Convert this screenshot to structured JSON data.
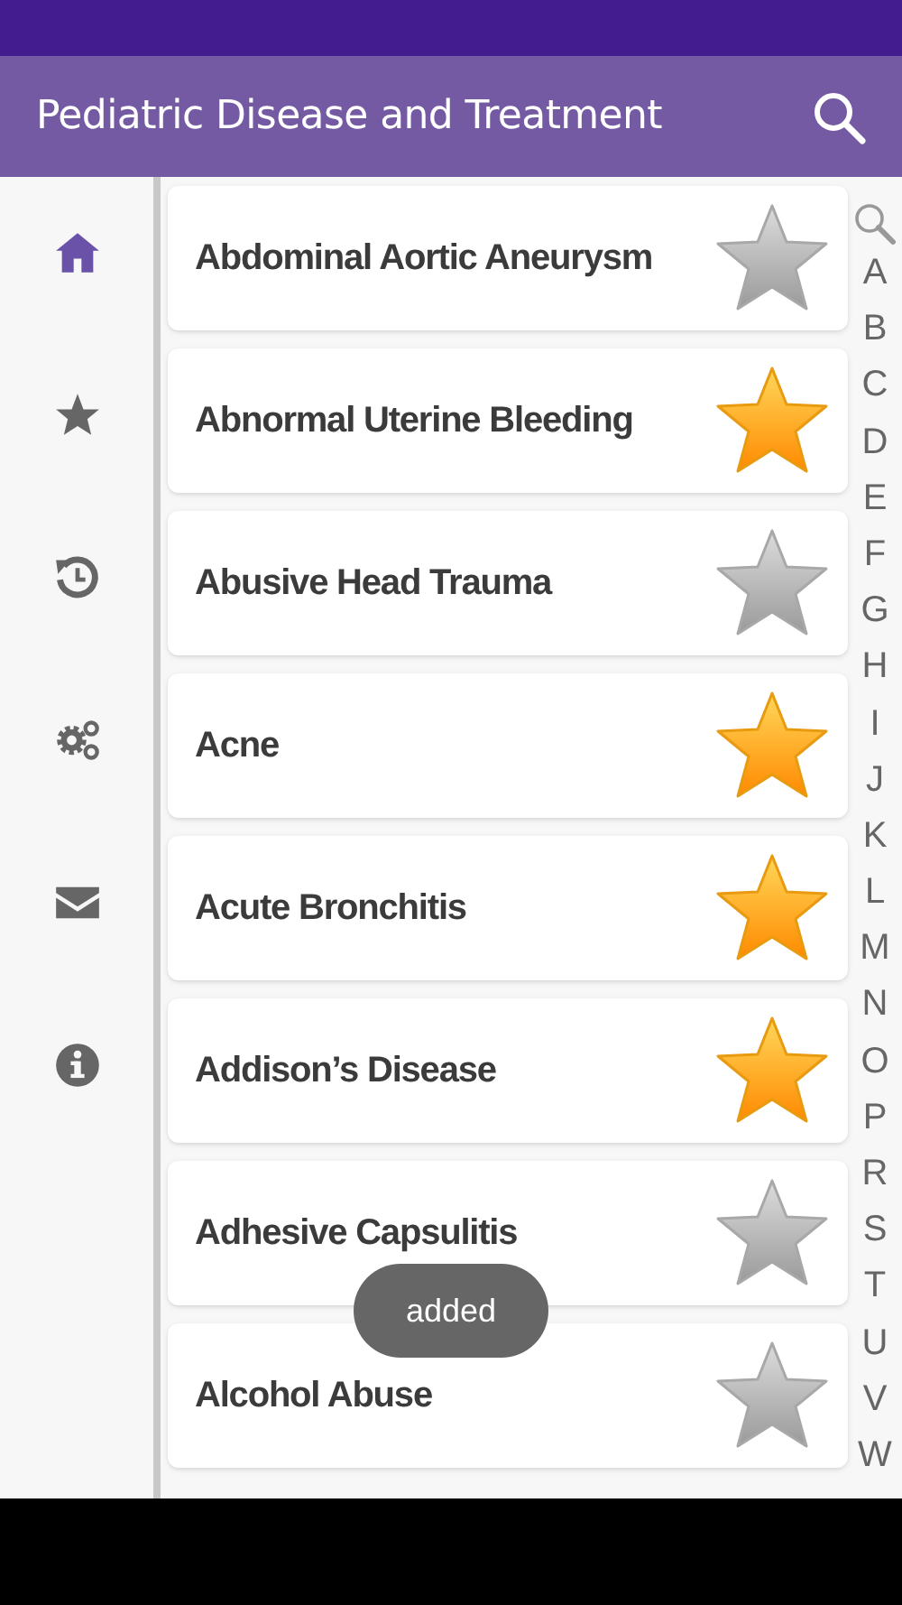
{
  "app_bar": {
    "title": "Pediatric Disease and Treatment"
  },
  "sidebar": {
    "items": [
      {
        "kind": "home",
        "selected": true
      },
      {
        "kind": "star",
        "selected": false
      },
      {
        "kind": "history",
        "selected": false
      },
      {
        "kind": "gears",
        "selected": false
      },
      {
        "kind": "mail",
        "selected": false
      },
      {
        "kind": "info",
        "selected": false
      }
    ]
  },
  "diseases": [
    {
      "name": "Abdominal Aortic Aneurysm",
      "favorite": false
    },
    {
      "name": "Abnormal Uterine Bleeding",
      "favorite": true
    },
    {
      "name": "Abusive Head Trauma",
      "favorite": false
    },
    {
      "name": "Acne",
      "favorite": true
    },
    {
      "name": "Acute Bronchitis",
      "favorite": true
    },
    {
      "name": "Addison’s Disease",
      "favorite": true
    },
    {
      "name": "Adhesive Capsulitis",
      "favorite": false
    },
    {
      "name": "Alcohol Abuse",
      "favorite": false
    }
  ],
  "index_letters": [
    "A",
    "B",
    "C",
    "D",
    "E",
    "F",
    "G",
    "H",
    "I",
    "J",
    "K",
    "L",
    "M",
    "N",
    "O",
    "P",
    "R",
    "S",
    "T",
    "U",
    "V",
    "W"
  ],
  "toast": {
    "text": "added"
  }
}
